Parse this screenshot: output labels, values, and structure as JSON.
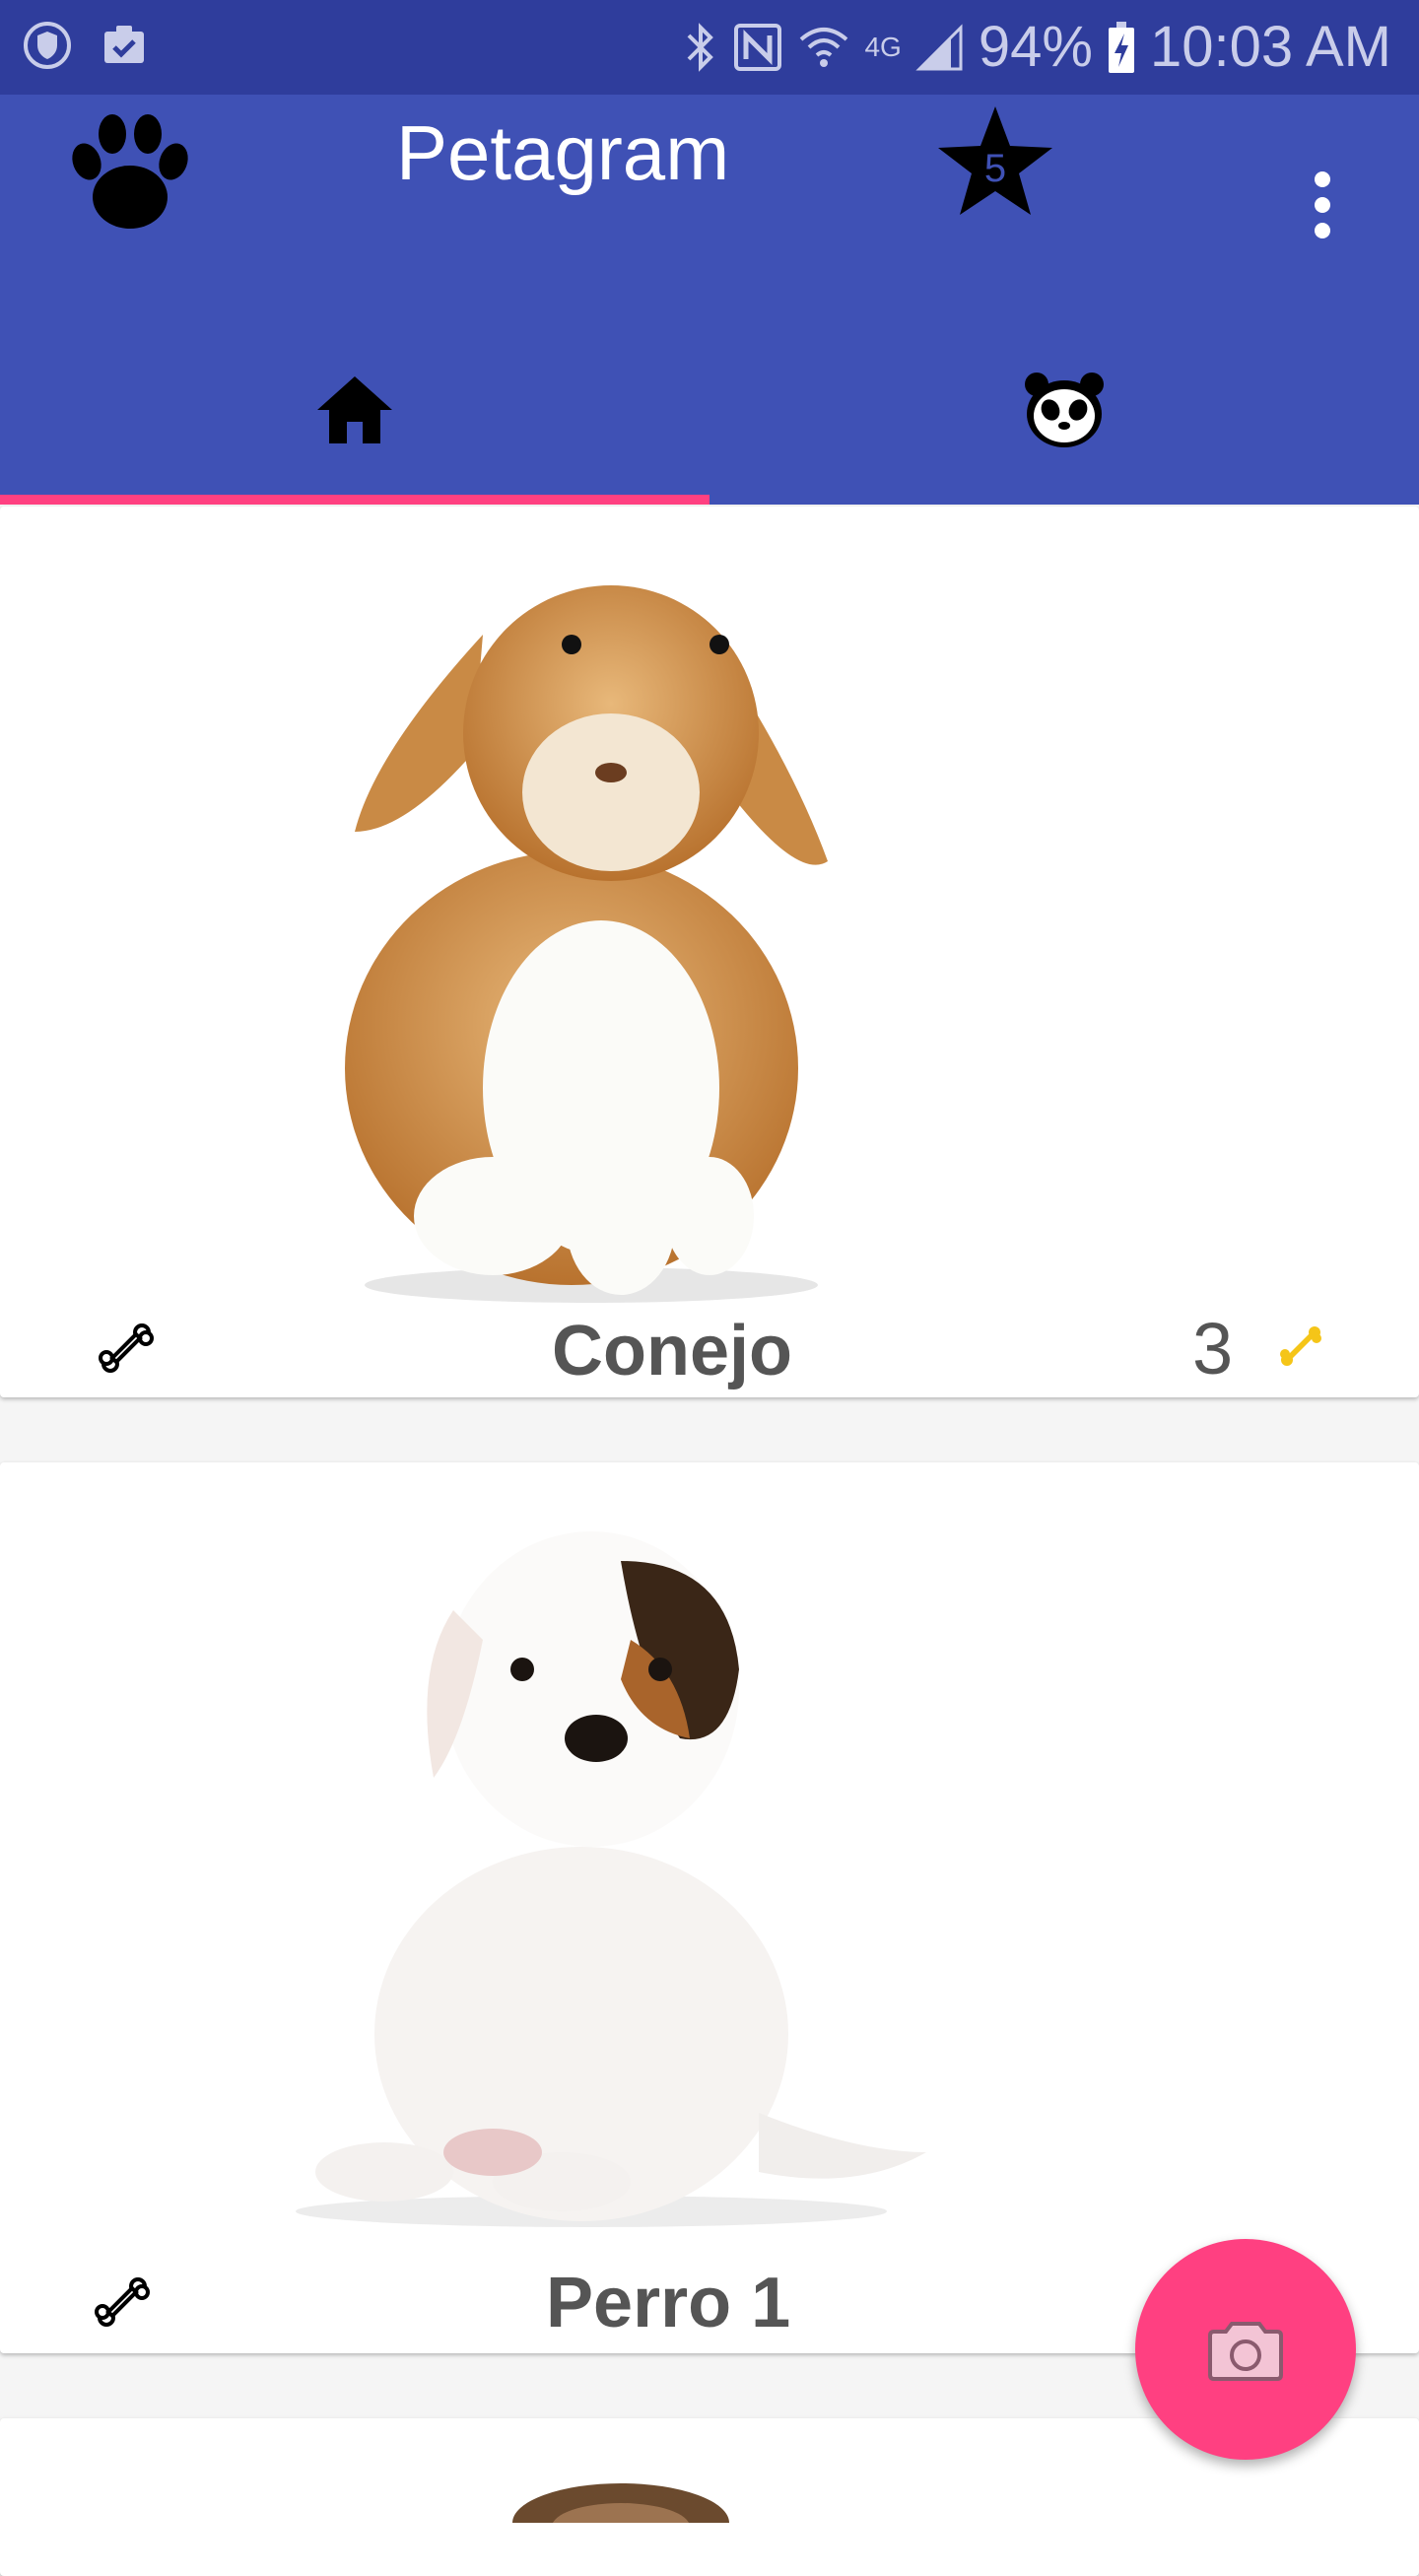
{
  "status_bar": {
    "battery_percent": "94%",
    "time": "10:03 AM",
    "network": "4G"
  },
  "app_bar": {
    "title": "Petagram",
    "star_badge": "5"
  },
  "tabs": [
    {
      "icon": "home-icon",
      "selected": true
    },
    {
      "icon": "panda-icon",
      "selected": false
    }
  ],
  "pets": [
    {
      "name": "Conejo",
      "likes": "3"
    },
    {
      "name": "Perro 1"
    }
  ],
  "colors": {
    "primary": "#3f51b5",
    "primary_dark": "#2f3d9c",
    "accent": "#ff4081",
    "like_gold": "#f5c518"
  }
}
